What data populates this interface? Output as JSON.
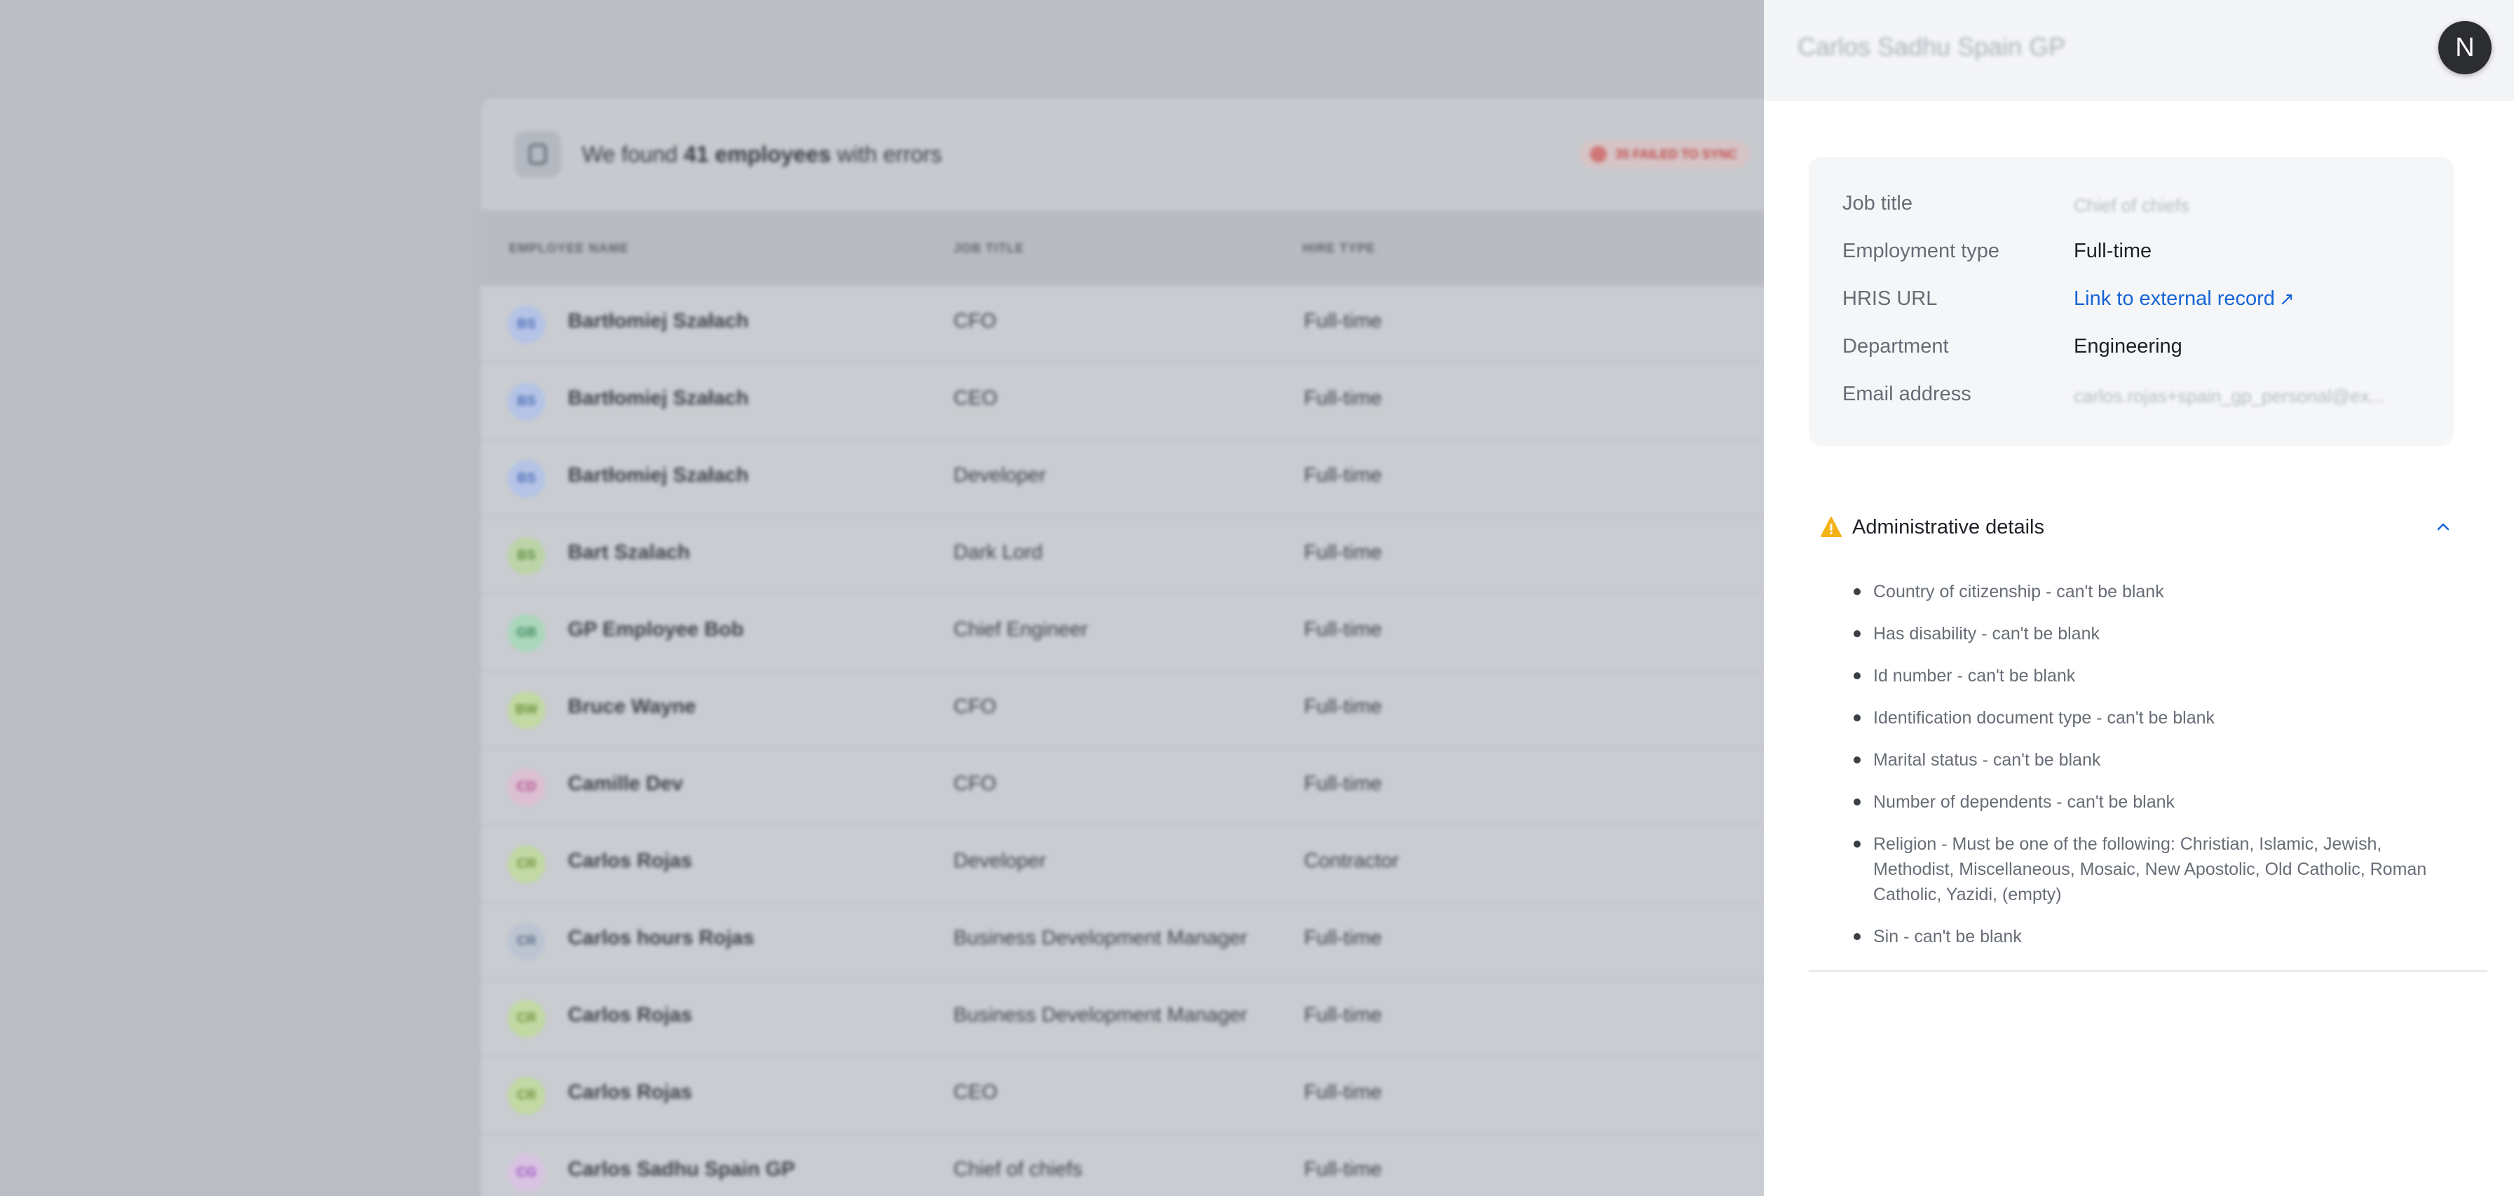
{
  "background": {
    "header": {
      "prefix": "We found",
      "count": "41 employees",
      "suffix": "with errors",
      "sync_badge": "35 FAILED TO SYNC"
    },
    "columns": [
      "EMPLOYEE NAME",
      "JOB TITLE",
      "HIRE TYPE"
    ],
    "rows": [
      {
        "initials": "BS",
        "name": "Bartłomiej Szałach",
        "title": "CFO",
        "hire": "Full-time",
        "color": "#b4c3e6",
        "text_color": "#4d6fb5"
      },
      {
        "initials": "BS",
        "name": "Bartłomiej Szałach",
        "title": "CEO",
        "hire": "Full-time",
        "color": "#b4c3e6",
        "text_color": "#4d6fb5"
      },
      {
        "initials": "BS",
        "name": "Bartłomiej Szałach",
        "title": "Developer",
        "hire": "Full-time",
        "color": "#b4c3e6",
        "text_color": "#4d6fb5"
      },
      {
        "initials": "BS",
        "name": "Bart Szalach",
        "title": "Dark Lord",
        "hire": "Full-time",
        "color": "#bcd4a8",
        "text_color": "#5e8c3c"
      },
      {
        "initials": "GB",
        "name": "GP Employee Bob",
        "title": "Chief Engineer",
        "hire": "Full-time",
        "color": "#abd7bc",
        "text_color": "#3f8a5e"
      },
      {
        "initials": "BW",
        "name": "Bruce Wayne",
        "title": "CFO",
        "hire": "Full-time",
        "color": "#c2d9a4",
        "text_color": "#6c9237"
      },
      {
        "initials": "CD",
        "name": "Camille Dev",
        "title": "CFO",
        "hire": "Full-time",
        "color": "#dcbfd2",
        "text_color": "#b04d8c"
      },
      {
        "initials": "CR",
        "name": "Carlos Rojas",
        "title": "Developer",
        "hire": "Contractor",
        "color": "#c2d9a4",
        "text_color": "#6c9237"
      },
      {
        "initials": "CR",
        "name": "Carlos hours Rojas",
        "title": "Business Development Manager",
        "hire": "Full-time",
        "color": "#bcc4d2",
        "text_color": "#5b6b86"
      },
      {
        "initials": "CR",
        "name": "Carlos Rojas",
        "title": "Business Development Manager",
        "hire": "Full-time",
        "color": "#c2d9a4",
        "text_color": "#6c9237"
      },
      {
        "initials": "CR",
        "name": "Carlos Rojas",
        "title": "CEO",
        "hire": "Full-time",
        "color": "#c2d9a4",
        "text_color": "#6c9237"
      },
      {
        "initials": "CG",
        "name": "Carlos Sadhu Spain GP",
        "title": "Chief of chiefs",
        "hire": "Full-time",
        "color": "#d8c3e2",
        "text_color": "#9a4fbf"
      }
    ]
  },
  "panel": {
    "title": "Carlos Sadhu Spain GP",
    "logo_letter": "N",
    "info": [
      {
        "label": "Job title",
        "value": "Chief of chiefs",
        "kind": "blurred"
      },
      {
        "label": "Employment type",
        "value": "Full-time",
        "kind": "text"
      },
      {
        "label": "HRIS URL",
        "value": "Link to external record",
        "kind": "link"
      },
      {
        "label": "Department",
        "value": "Engineering",
        "kind": "text"
      },
      {
        "label": "Email address",
        "value": "carlos.rojas+spain_gp_personal@ex...",
        "kind": "blurred"
      }
    ],
    "admin": {
      "title": "Administrative details",
      "warning_icon": "warning-triangle-icon",
      "collapse_icon": "chevron-up-icon",
      "errors": [
        "Country of citizenship - can't be blank",
        "Has disability - can't be blank",
        "Id number - can't be blank",
        "Identification document type - can't be blank",
        "Marital status - can't be blank",
        "Number of dependents - can't be blank",
        "Religion - Must be one of the following: Christian, Islamic, Jewish, Methodist, Miscellaneous, Mosaic, New Apostolic, Old Catholic, Roman Catholic, Yazidi, (empty)",
        "Sin - can't be blank"
      ]
    }
  }
}
